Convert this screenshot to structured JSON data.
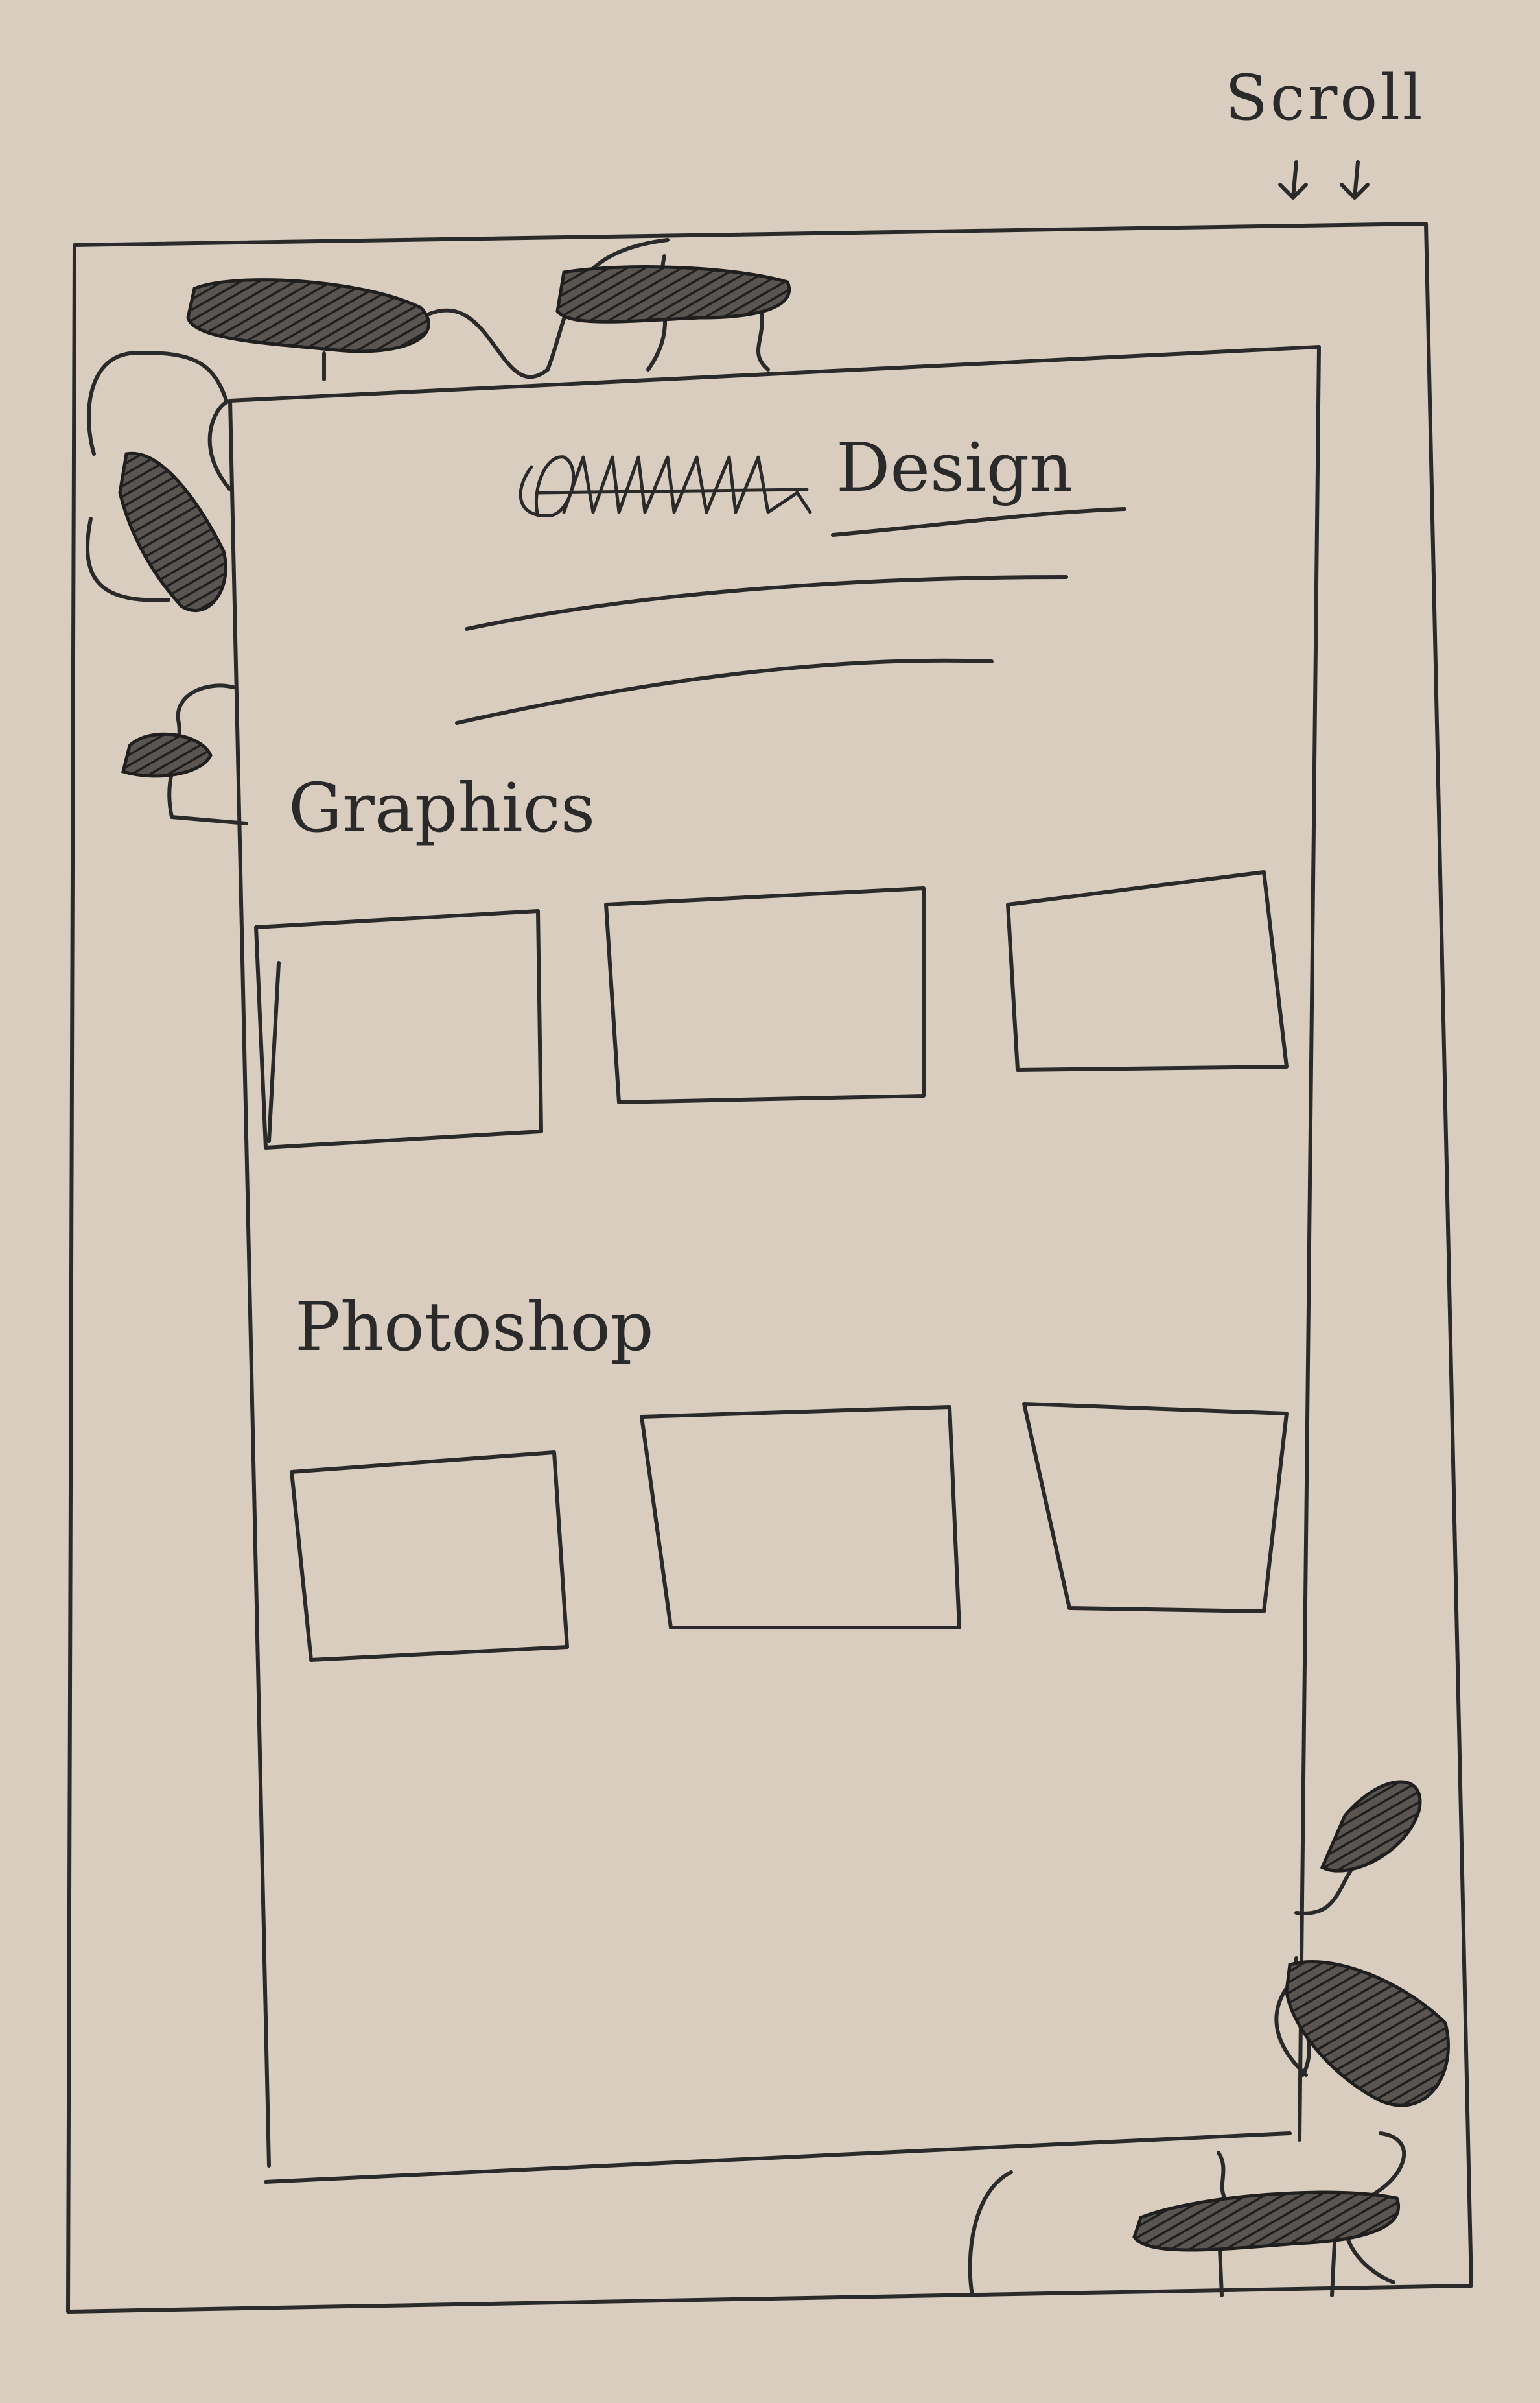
{
  "annotation": {
    "scroll_label": "Scroll"
  },
  "header": {
    "title_scribble": "scribbled-out word",
    "title": "Design",
    "subtitle_lines": 2
  },
  "sections": [
    {
      "heading": "Graphics",
      "thumbnail_count": 3
    },
    {
      "heading": "Photoshop",
      "thumbnail_count": 3
    }
  ],
  "icons": [
    "top-nav-scribble-icon",
    "top-nav-scribble-icon",
    "side-nav-scribble-icon",
    "side-nav-scribble-icon",
    "corner-scribble-icon",
    "corner-scribble-icon",
    "corner-scribble-icon"
  ],
  "colors": {
    "paper": "#d9cdbf",
    "ink": "#2a2a2a"
  }
}
